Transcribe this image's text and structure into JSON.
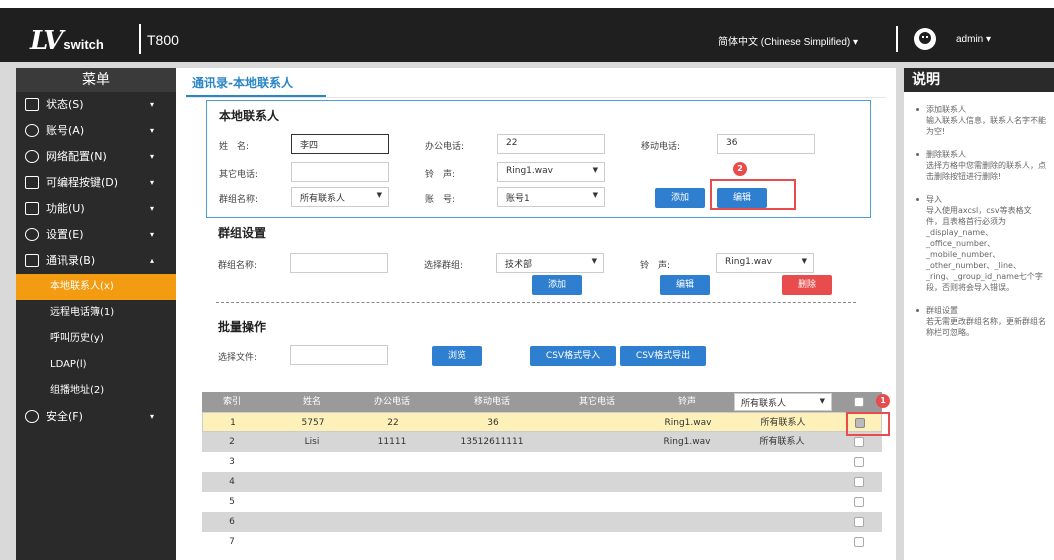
{
  "header": {
    "logo_main": "LV",
    "logo_sub": "switch",
    "model": "T800",
    "language": "简体中文 (Chinese Simplified) ▾",
    "user": "admin ▾"
  },
  "sidebar": {
    "title": "菜单",
    "items": [
      {
        "label": "状态(S)",
        "arrow": "▾"
      },
      {
        "label": "账号(A)",
        "arrow": "▾"
      },
      {
        "label": "网络配置(N)",
        "arrow": "▾"
      },
      {
        "label": "可编程按键(D)",
        "arrow": "▾"
      },
      {
        "label": "功能(U)",
        "arrow": "▾"
      },
      {
        "label": "设置(E)",
        "arrow": "▾"
      },
      {
        "label": "通讯录(B)",
        "arrow": "▴"
      }
    ],
    "subitems": [
      "本地联系人(x)",
      "远程电话簿(1)",
      "呼叫历史(y)",
      "LDAP(l)",
      "组播地址(2)"
    ],
    "security": {
      "label": "安全(F)",
      "arrow": "▾"
    }
  },
  "main": {
    "page_title": "通讯录-本地联系人",
    "local": {
      "heading": "本地联系人",
      "name_label": "姓　名:",
      "name_value": "李四",
      "office_label": "办公电话:",
      "office_value": "22",
      "mobile_label": "移动电话:",
      "mobile_value": "36",
      "other_label": "其它电话:",
      "other_value": "",
      "ring_label": "铃　声:",
      "ring_value": "Ring1.wav",
      "group_label": "群组名称:",
      "group_value": "所有联系人",
      "account_label": "账　号:",
      "account_value": "账号1",
      "add_button": "添加",
      "edit_button": "编辑",
      "badge": "2"
    },
    "group": {
      "heading": "群组设置",
      "name_label": "群组名称:",
      "name_value": "",
      "select_label": "选择群组:",
      "select_value": "技术部",
      "ring_label": "铃　声:",
      "ring_value": "Ring1.wav",
      "add_button": "添加",
      "edit_button": "编辑",
      "delete_button": "删除"
    },
    "batch": {
      "heading": "批量操作",
      "file_label": "选择文件:",
      "file_value": "",
      "browse_button": "浏览",
      "import_button": "CSV格式导入",
      "export_button": "CSV格式导出"
    },
    "table": {
      "headers": [
        "索引",
        "姓名",
        "办公电话",
        "移动电话",
        "其它电话",
        "铃声"
      ],
      "filter": "所有联系人",
      "badge": "1",
      "rows": [
        {
          "index": "1",
          "name": "5757",
          "office": "22",
          "mobile": "36",
          "other": "",
          "ring": "Ring1.wav",
          "group": "所有联系人"
        },
        {
          "index": "2",
          "name": "Lisi",
          "office": "11111",
          "mobile": "13512611111",
          "other": "",
          "ring": "Ring1.wav",
          "group": "所有联系人"
        },
        {
          "index": "3",
          "name": "",
          "office": "",
          "mobile": "",
          "other": "",
          "ring": "",
          "group": ""
        },
        {
          "index": "4",
          "name": "",
          "office": "",
          "mobile": "",
          "other": "",
          "ring": "",
          "group": ""
        },
        {
          "index": "5",
          "name": "",
          "office": "",
          "mobile": "",
          "other": "",
          "ring": "",
          "group": ""
        },
        {
          "index": "6",
          "name": "",
          "office": "",
          "mobile": "",
          "other": "",
          "ring": "",
          "group": ""
        },
        {
          "index": "7",
          "name": "",
          "office": "",
          "mobile": "",
          "other": "",
          "ring": "",
          "group": ""
        }
      ]
    }
  },
  "help": {
    "title": "说明",
    "items": [
      {
        "title": "添加联系人",
        "text": "输入联系人信息，联系人名字不能为空!"
      },
      {
        "title": "删除联系人",
        "text": "选择方格中您需删除的联系人，点击删除按钮进行删除!"
      },
      {
        "title": "导入",
        "text": "导入使用axcsl，csv等表格文件，且表格首行必须为_display_name、_office_number、_mobile_number、_other_number、_line、_ring、_group_id_name七个字段，否则将会导入错误。"
      },
      {
        "title": "群组设置",
        "text": "若无需更改群组名称，更新群组名称栏可忽略。"
      }
    ]
  }
}
